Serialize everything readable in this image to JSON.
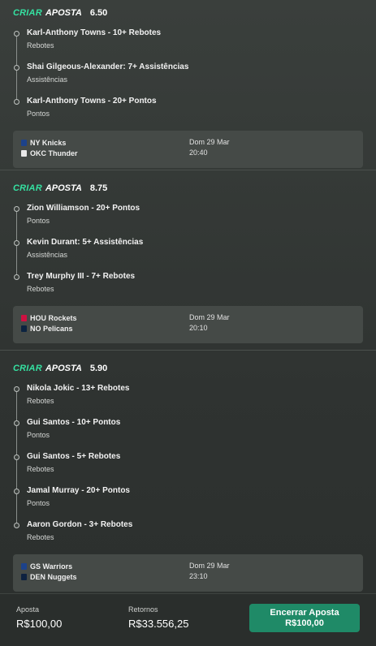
{
  "bets": [
    {
      "label_criar": "CRIAR",
      "label_aposta": "APOSTA",
      "odds": "6.50",
      "legs": [
        {
          "title": "Karl-Anthony Towns - 10+ Rebotes",
          "market": "Rebotes"
        },
        {
          "title": "Shai Gilgeous-Alexander: 7+ Assistências",
          "market": "Assistências"
        },
        {
          "title": "Karl-Anthony Towns - 20+ Pontos",
          "market": "Pontos"
        }
      ],
      "match": {
        "home": "NY Knicks",
        "away": "OKC Thunder",
        "home_color": "#1d428a",
        "away_color": "#e9e9e9",
        "date": "Dom 29 Mar",
        "time": "20:40"
      }
    },
    {
      "label_criar": "CRIAR",
      "label_aposta": "APOSTA",
      "odds": "8.75",
      "legs": [
        {
          "title": "Zion Williamson - 20+ Pontos",
          "market": "Pontos"
        },
        {
          "title": "Kevin Durant: 5+ Assistências",
          "market": "Assistências"
        },
        {
          "title": "Trey Murphy III - 7+ Rebotes",
          "market": "Rebotes"
        }
      ],
      "match": {
        "home": "HOU Rockets",
        "away": "NO Pelicans",
        "home_color": "#ce1141",
        "away_color": "#0c2340",
        "date": "Dom 29 Mar",
        "time": "20:10"
      }
    },
    {
      "label_criar": "CRIAR",
      "label_aposta": "APOSTA",
      "odds": "5.90",
      "legs": [
        {
          "title": "Nikola Jokic - 13+ Rebotes",
          "market": "Rebotes"
        },
        {
          "title": "Gui Santos - 10+ Pontos",
          "market": "Pontos"
        },
        {
          "title": "Gui Santos - 5+ Rebotes",
          "market": "Rebotes"
        },
        {
          "title": "Jamal Murray - 20+ Pontos",
          "market": "Pontos"
        },
        {
          "title": "Aaron Gordon - 3+ Rebotes",
          "market": "Rebotes"
        }
      ],
      "match": {
        "home": "GS Warriors",
        "away": "DEN Nuggets",
        "home_color": "#1d428a",
        "away_color": "#0e2240",
        "date": "Dom 29 Mar",
        "time": "23:10"
      }
    }
  ],
  "footer": {
    "stake_label": "Aposta",
    "stake_value": "R$100,00",
    "returns_label": "Retornos",
    "returns_value": "R$33.556,25",
    "cashout_label": "Encerrar Aposta",
    "cashout_value": "R$100,00"
  },
  "colors": {
    "accent": "#35e0a1",
    "cashout_button": "#1f8a67"
  }
}
